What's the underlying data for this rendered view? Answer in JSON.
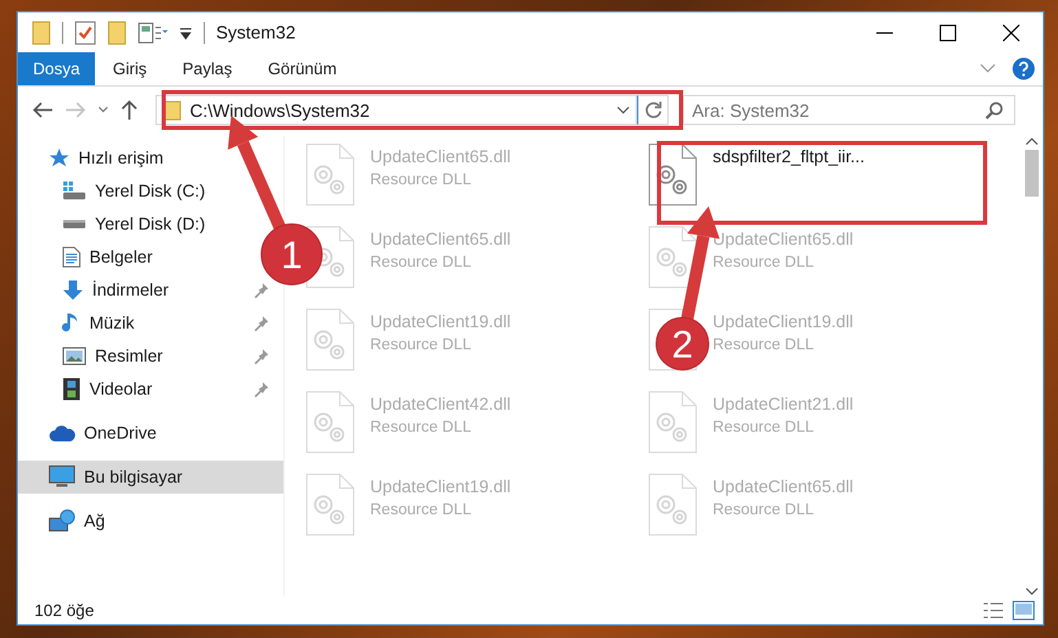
{
  "window": {
    "title": "System32"
  },
  "ribbon": {
    "tabs": [
      {
        "label": "Dosya",
        "selected": true
      },
      {
        "label": "Giriş",
        "selected": false
      },
      {
        "label": "Paylaş",
        "selected": false
      },
      {
        "label": "Görünüm",
        "selected": false
      }
    ]
  },
  "address_bar": {
    "path": "C:\\Windows\\System32"
  },
  "search": {
    "placeholder": "Ara: System32"
  },
  "navigation": {
    "items": [
      {
        "label": "Hızlı erişim",
        "kind": "star",
        "selected": false,
        "children": [
          {
            "label": "Yerel Disk (C:)",
            "kind": "drive-c",
            "selected": false
          },
          {
            "label": "Yerel Disk (D:)",
            "kind": "drive",
            "selected": false
          },
          {
            "label": "Belgeler",
            "kind": "document",
            "selected": false
          },
          {
            "label": "İndirmeler",
            "kind": "download",
            "selected": false,
            "pinned": true
          },
          {
            "label": "Müzik",
            "kind": "music",
            "selected": false,
            "pinned": true
          },
          {
            "label": "Resimler",
            "kind": "picture",
            "selected": false,
            "pinned": true
          },
          {
            "label": "Videolar",
            "kind": "video",
            "selected": false,
            "pinned": true
          }
        ]
      },
      {
        "label": "OneDrive",
        "kind": "cloud",
        "selected": false
      },
      {
        "label": "Bu bilgisayar",
        "kind": "computer",
        "selected": true
      },
      {
        "label": "Ağ",
        "kind": "network",
        "selected": false
      }
    ]
  },
  "files": [
    {
      "name": "UpdateClient65.dll",
      "type": "Resource DLL",
      "faded": true
    },
    {
      "name": "sdspfilter2_fltpt_iir...",
      "faded": false
    },
    {
      "name": "UpdateClient65.dll",
      "type": "Resource DLL",
      "faded": true
    },
    {
      "name": "UpdateClient65.dll",
      "type": "Resource DLL",
      "faded": true
    },
    {
      "name": "UpdateClient19.dll",
      "type": "Resource DLL",
      "faded": true
    },
    {
      "name": "UpdateClient19.dll",
      "type": "Resource DLL",
      "faded": true
    },
    {
      "name": "UpdateClient42.dll",
      "type": "Resource DLL",
      "faded": true
    },
    {
      "name": "UpdateClient21.dll",
      "type": "Resource DLL",
      "faded": true
    },
    {
      "name": "UpdateClient19.dll",
      "type": "Resource DLL",
      "faded": true
    },
    {
      "name": "UpdateClient65.dll",
      "type": "Resource DLL",
      "faded": true
    }
  ],
  "status_bar": {
    "item_count": "102 öğe"
  },
  "callouts": [
    {
      "number": "1"
    },
    {
      "number": "2"
    }
  ]
}
